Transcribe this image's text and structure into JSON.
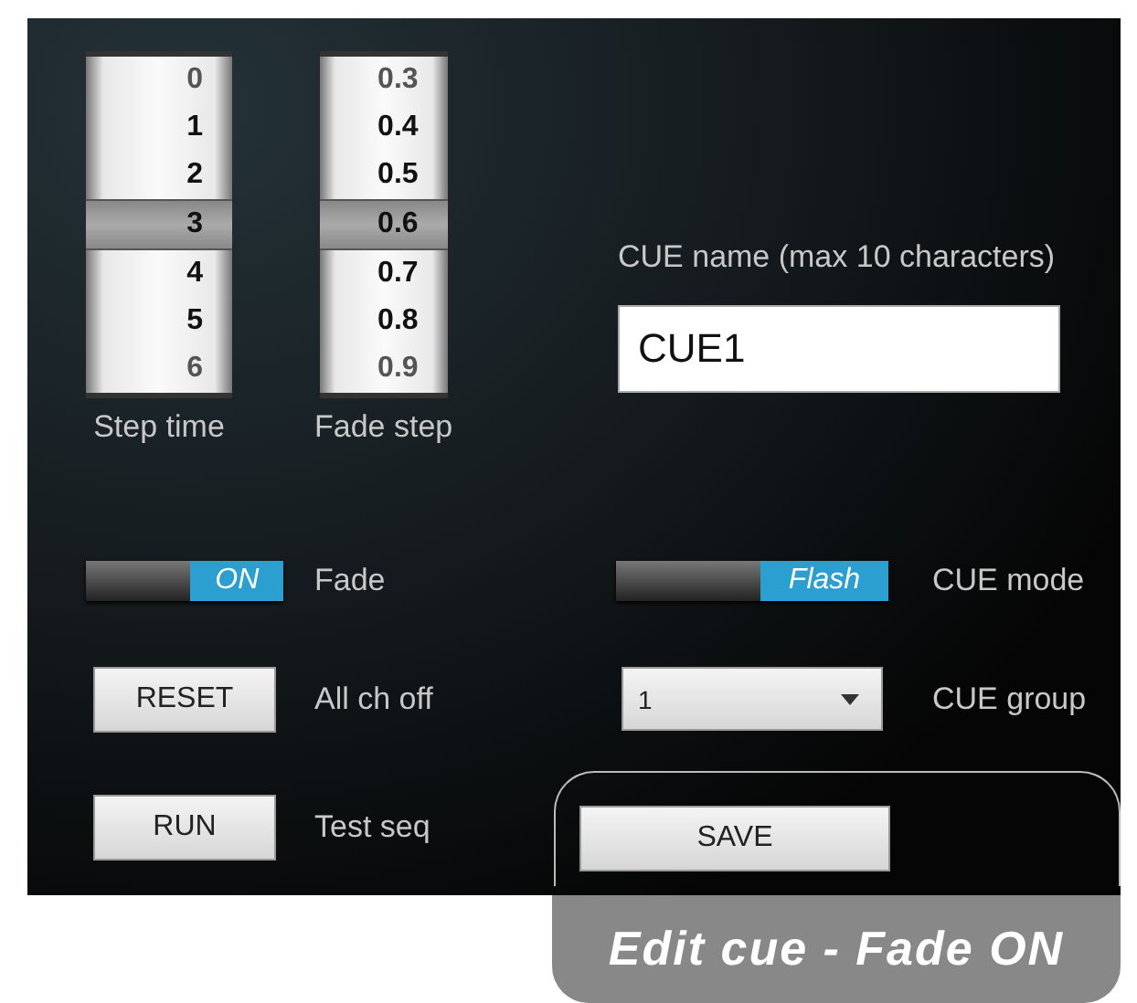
{
  "pickers": [
    {
      "label": "Step time",
      "items": [
        {
          "value": "0",
          "selected": false
        },
        {
          "value": "1",
          "selected": false
        },
        {
          "value": "2",
          "selected": false
        },
        {
          "value": "3",
          "selected": true
        },
        {
          "value": "4",
          "selected": false
        },
        {
          "value": "5",
          "selected": false
        },
        {
          "value": "6",
          "selected": false
        }
      ]
    },
    {
      "label": "Fade step",
      "items": [
        {
          "value": "0.3",
          "selected": false
        },
        {
          "value": "0.4",
          "selected": false
        },
        {
          "value": "0.5",
          "selected": false
        },
        {
          "value": "0.6",
          "selected": true
        },
        {
          "value": "0.7",
          "selected": false
        },
        {
          "value": "0.8",
          "selected": false
        },
        {
          "value": "0.9",
          "selected": false
        }
      ]
    }
  ],
  "cue_name": {
    "label": "CUE name (max 10 characters)",
    "value": "CUE1"
  },
  "left_controls": [
    {
      "kind": "toggle",
      "text": "ON",
      "on": true,
      "label": "Fade"
    },
    {
      "kind": "button",
      "text": "RESET",
      "label": "All ch off"
    },
    {
      "kind": "button",
      "text": "RUN",
      "label": "Test seq"
    }
  ],
  "right_controls": [
    {
      "kind": "toggle",
      "text": "Flash",
      "on": true,
      "label": "CUE mode",
      "highlighted": false
    },
    {
      "kind": "dropdown",
      "text": "1",
      "label": "CUE group",
      "highlighted": false
    },
    {
      "kind": "button",
      "text": "SAVE",
      "highlighted": true
    }
  ],
  "caption": "Edit cue - Fade ON"
}
